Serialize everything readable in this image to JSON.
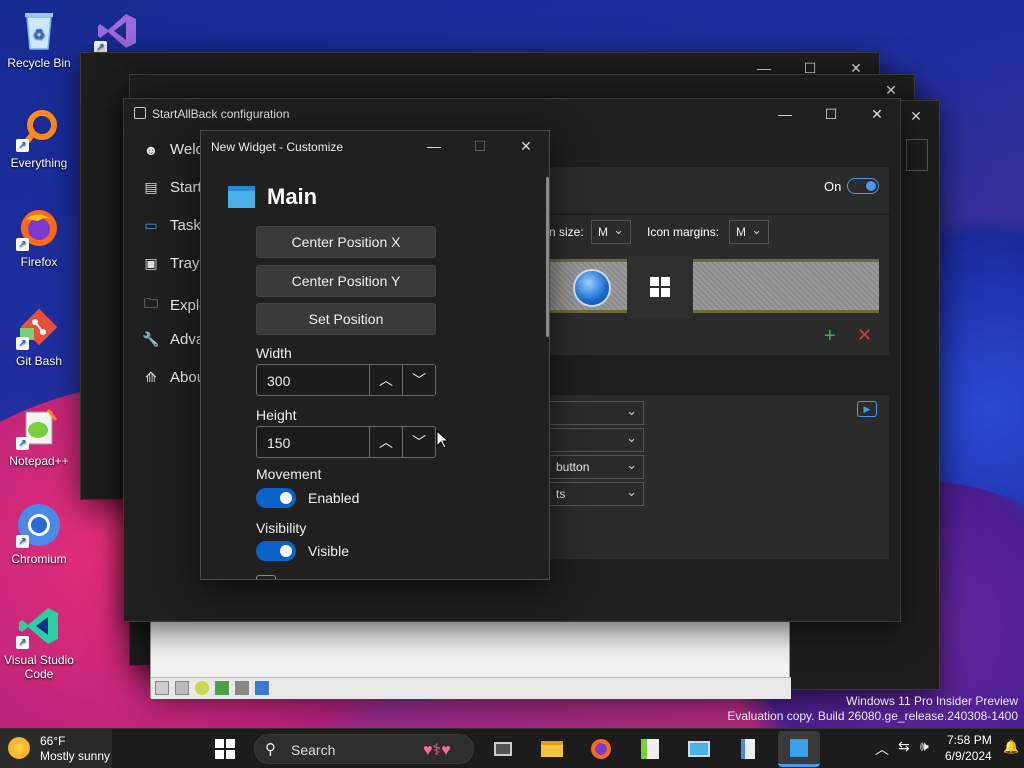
{
  "desktop": {
    "icons": [
      {
        "label": "Recycle Bin"
      },
      {
        "label": "Everything"
      },
      {
        "label": "Firefox"
      },
      {
        "label": "Git Bash"
      },
      {
        "label": "Notepad++"
      },
      {
        "label": "Chromium"
      },
      {
        "label": "Visual Studio Code"
      }
    ],
    "watermark_line1": "Windows 11 Pro Insider Preview",
    "watermark_line2": "Evaluation copy. Build 26080.ge_release.240308-1400"
  },
  "startallback": {
    "title": "StartAllBack configuration",
    "nav": [
      {
        "label": "Welco",
        "icon": "smile-icon"
      },
      {
        "label": "Start",
        "icon": "start-menu-icon"
      },
      {
        "label": "Taskb",
        "icon": "taskbar-icon"
      },
      {
        "label": "Tray i",
        "icon": "tray-icon"
      },
      {
        "label": "Explo",
        "icon": "folder-icon"
      },
      {
        "label": "Adva",
        "icon": "wrench-icon"
      },
      {
        "label": "Abou",
        "icon": "about-icon"
      }
    ],
    "on_label": "On",
    "icon_size_label": "n size:",
    "icon_size_value": "M",
    "icon_margins_label": "Icon margins:",
    "icon_margins_value": "M",
    "dropdowns": [
      "",
      "",
      "button",
      "ts"
    ]
  },
  "widget": {
    "title": "New Widget - Customize",
    "section_title": "Main",
    "buttons": {
      "center_x": "Center Position X",
      "center_y": "Center Position Y",
      "set_position": "Set Position"
    },
    "width_label": "Width",
    "width_value": "300",
    "height_label": "Height",
    "height_value": "150",
    "movement_label": "Movement",
    "movement_state": "Enabled",
    "visibility_label": "Visibility",
    "visibility_state": "Visible"
  },
  "taskbar": {
    "weather_temp": "66°F",
    "weather_desc": "Mostly sunny",
    "search_label": "Search",
    "time": "7:58 PM",
    "date": "6/9/2024"
  }
}
